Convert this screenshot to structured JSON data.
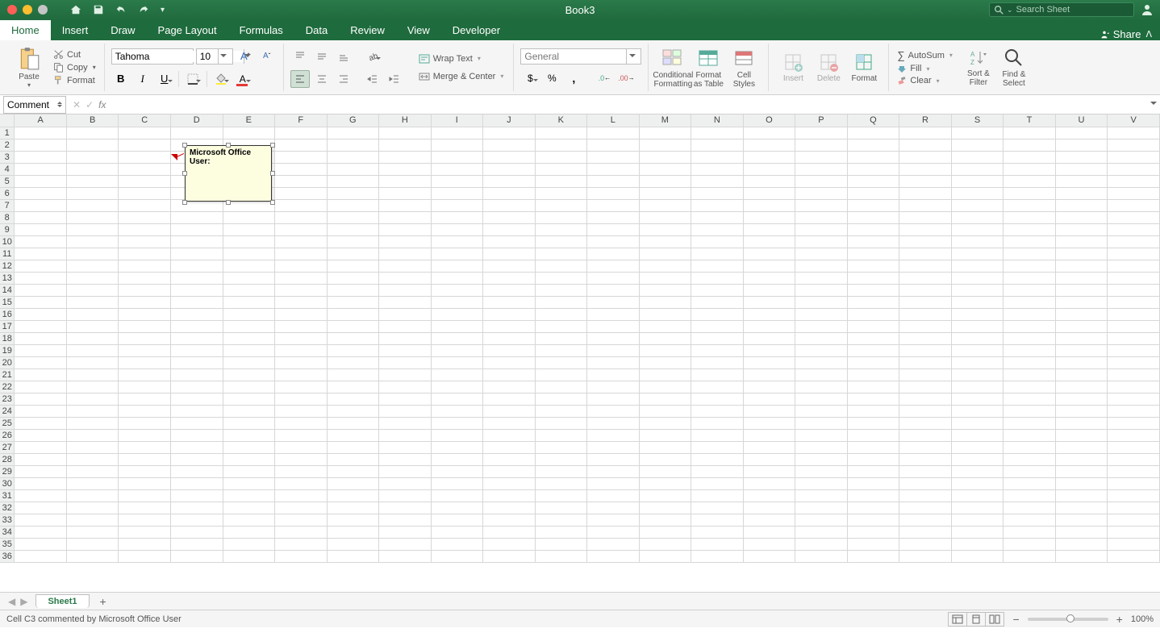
{
  "title": "Book3",
  "search_placeholder": "Search Sheet",
  "tabs": [
    "Home",
    "Insert",
    "Draw",
    "Page Layout",
    "Formulas",
    "Data",
    "Review",
    "View",
    "Developer"
  ],
  "active_tab": "Home",
  "share": "Share",
  "ribbon": {
    "paste": "Paste",
    "cut": "Cut",
    "copy": "Copy",
    "format_painter": "Format",
    "font_name": "Tahoma",
    "font_size": "10",
    "wrap_text": "Wrap Text",
    "merge_center": "Merge & Center",
    "number_format": "General",
    "conditional_formatting": "Conditional Formatting",
    "format_as_table": "Format as Table",
    "cell_styles": "Cell Styles",
    "insert": "Insert",
    "delete": "Delete",
    "format": "Format",
    "autosum": "AutoSum",
    "fill": "Fill",
    "clear": "Clear",
    "sort_filter": "Sort & Filter",
    "find_select": "Find & Select"
  },
  "name_box": "Comment",
  "formula": "",
  "columns": [
    "A",
    "B",
    "C",
    "D",
    "E",
    "F",
    "G",
    "H",
    "I",
    "J",
    "K",
    "L",
    "M",
    "N",
    "O",
    "P",
    "Q",
    "R",
    "S",
    "T",
    "U",
    "V"
  ],
  "rows": 36,
  "comment": {
    "cell": "C3",
    "author_line": "Microsoft Office User:",
    "body": ""
  },
  "sheet_name": "Sheet1",
  "status": "Cell C3 commented by Microsoft Office User",
  "zoom": "100%"
}
